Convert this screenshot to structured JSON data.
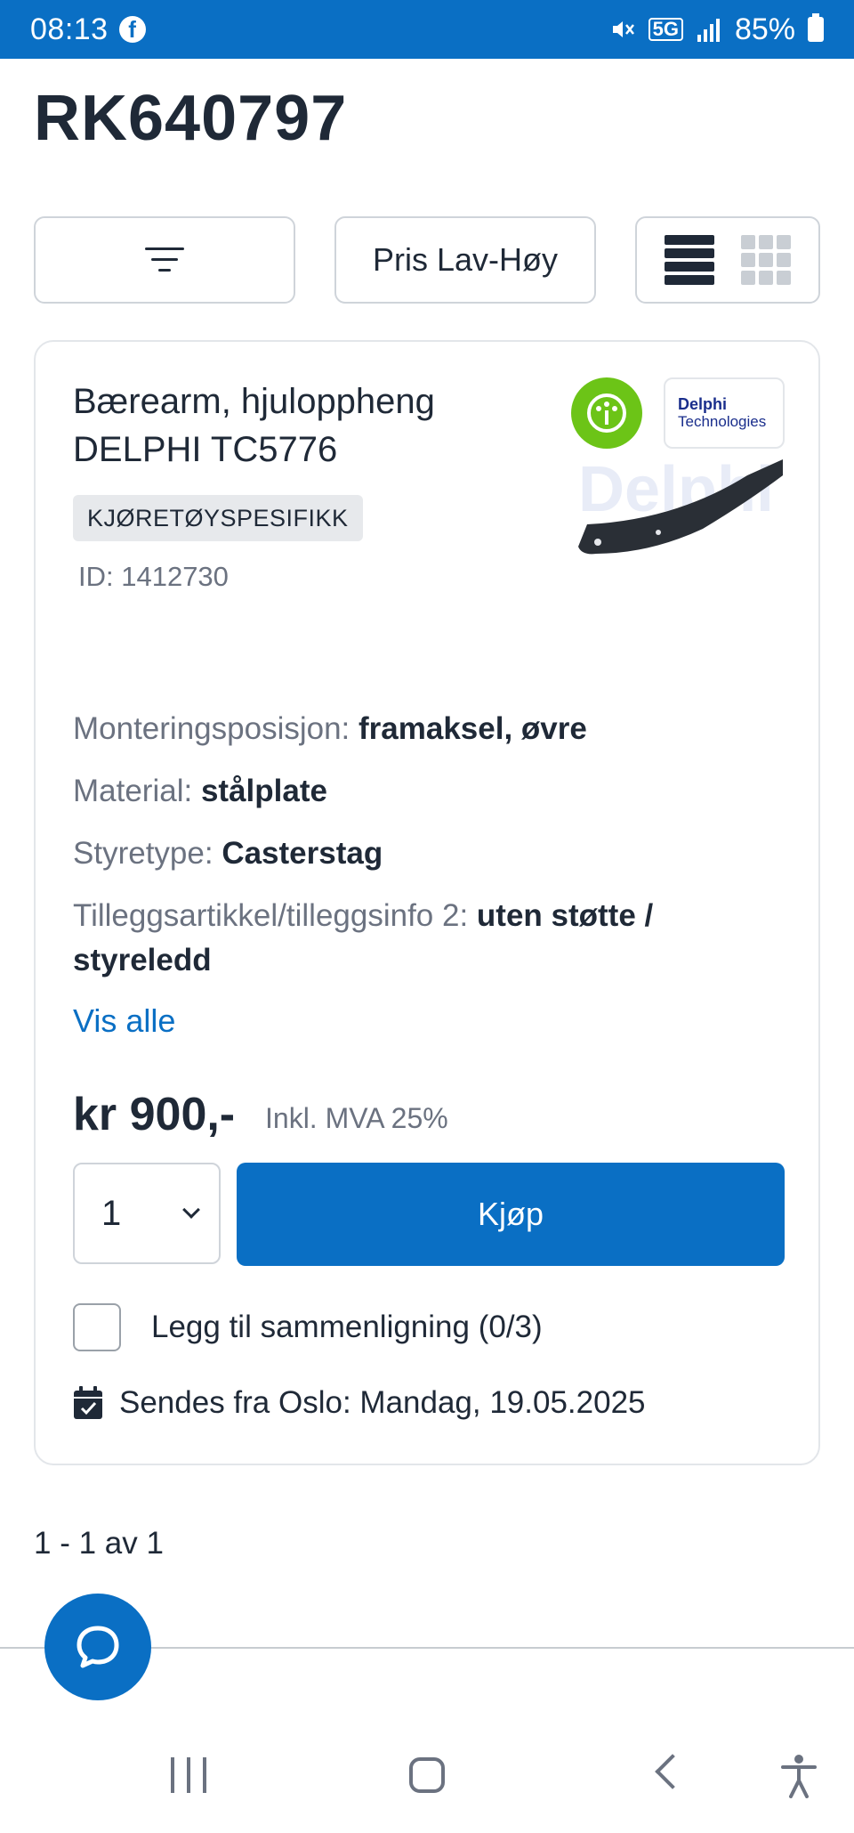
{
  "status_bar": {
    "time": "08:13",
    "network": "5G",
    "battery": "85%"
  },
  "page": {
    "title": "RK640797"
  },
  "toolbar": {
    "sort_label": "Pris Lav-Høy"
  },
  "product": {
    "title": "Bærearm, hjuloppheng DELPHI TC5776",
    "tag": "KJØRETØYSPESIFIKK",
    "id": "ID: 1412730",
    "brand_line1": "Delphi",
    "brand_line2": "Technologies",
    "specs": [
      {
        "key": "Monteringsposisjon:",
        "value": "framaksel, øvre"
      },
      {
        "key": "Material:",
        "value": "stålplate"
      },
      {
        "key": "Styretype:",
        "value": "Casterstag"
      },
      {
        "key": "Tilleggsartikkel/tilleggsinfo 2:",
        "value": "uten støtte / styreledd"
      }
    ],
    "show_all": "Vis alle",
    "price": "kr 900,-",
    "vat": "Inkl. MVA 25%",
    "quantity": "1",
    "buy_label": "Kjøp",
    "compare_label": "Legg til sammenligning (0/3)",
    "shipping": "Sendes fra Oslo: Mandag, 19.05.2025"
  },
  "pagination": {
    "text": "1 - 1 av 1"
  },
  "colors": {
    "primary": "#0a6fc4",
    "eco_green": "#6cc417"
  }
}
